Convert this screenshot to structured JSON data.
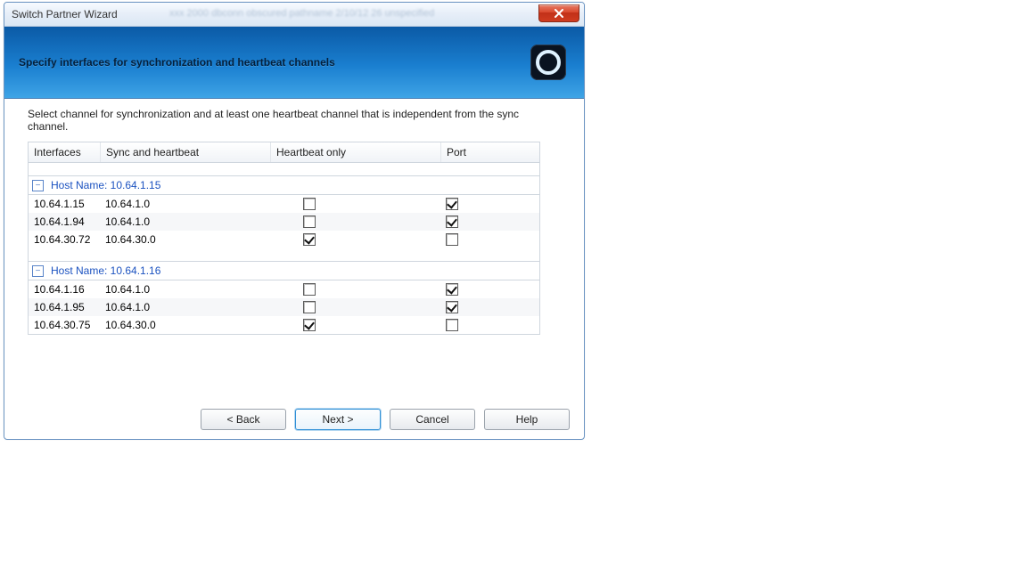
{
  "window": {
    "title": "Switch Partner Wizard"
  },
  "header": {
    "subtitle": "Specify interfaces for synchronization and heartbeat channels"
  },
  "instruction": "Select channel for synchronization and at least one heartbeat channel that is independent from the sync channel.",
  "columns": {
    "interfaces": "Interfaces",
    "sync": "Sync and heartbeat",
    "heartbeat": "Heartbeat only",
    "port": "Port"
  },
  "groups": [
    {
      "label": "Host Name: 10.64.1.15",
      "rows": [
        {
          "interface": "10.64.1.15",
          "sync": "10.64.1.0",
          "heartbeat_checked": false,
          "port_checked": true
        },
        {
          "interface": "10.64.1.94",
          "sync": "10.64.1.0",
          "heartbeat_checked": false,
          "port_checked": true
        },
        {
          "interface": "10.64.30.72",
          "sync": "10.64.30.0",
          "heartbeat_checked": true,
          "port_checked": false
        }
      ]
    },
    {
      "label": "Host Name: 10.64.1.16",
      "rows": [
        {
          "interface": "10.64.1.16",
          "sync": "10.64.1.0",
          "heartbeat_checked": false,
          "port_checked": true
        },
        {
          "interface": "10.64.1.95",
          "sync": "10.64.1.0",
          "heartbeat_checked": false,
          "port_checked": true
        },
        {
          "interface": "10.64.30.75",
          "sync": "10.64.30.0",
          "heartbeat_checked": true,
          "port_checked": false
        }
      ]
    }
  ],
  "buttons": {
    "back": "< Back",
    "next": "Next >",
    "cancel": "Cancel",
    "help": "Help"
  }
}
